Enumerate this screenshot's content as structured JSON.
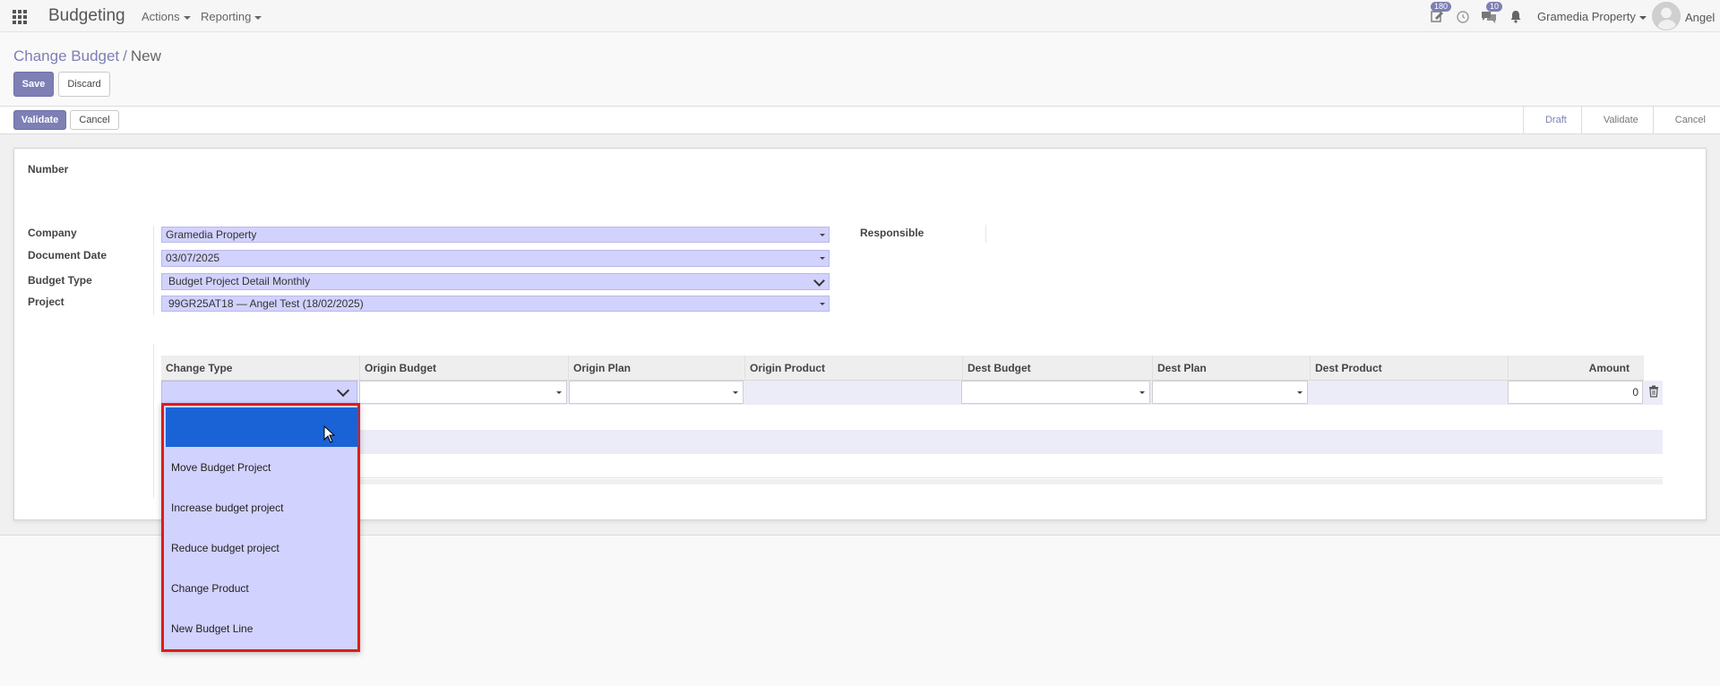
{
  "navbar": {
    "app_title": "Budgeting",
    "menus": [
      "Actions",
      "Reporting"
    ],
    "activity_badge": "180",
    "messages_badge": "10",
    "company": "Gramedia Property",
    "user": "Angel"
  },
  "control_panel": {
    "breadcrumb_parent": "Change Budget",
    "breadcrumb_sep": "/",
    "breadcrumb_current": "New",
    "save_label": "Save",
    "discard_label": "Discard"
  },
  "statusbar": {
    "validate_label": "Validate",
    "cancel_label": "Cancel",
    "stages": [
      "Draft",
      "Validate",
      "Cancel"
    ],
    "active_stage": "Draft"
  },
  "form": {
    "number_label": "Number",
    "company_label": "Company",
    "company_value": "Gramedia Property",
    "document_date_label": "Document Date",
    "document_date_value": "03/07/2025",
    "budget_type_label": "Budget Type",
    "budget_type_value": "Budget Project Detail Monthly",
    "project_label": "Project",
    "project_value": "99GR25AT18 — Angel Test (18/02/2025)",
    "responsible_label": "Responsible"
  },
  "table": {
    "columns": [
      "Change Type",
      "Origin Budget",
      "Origin Plan",
      "Origin Product",
      "Dest Budget",
      "Dest Plan",
      "Dest Product",
      "Amount"
    ],
    "row": {
      "amount": "0"
    }
  },
  "dropdown": {
    "options": [
      "",
      "Move Budget Project",
      "Increase budget project",
      "Reduce budget project",
      "Change Product",
      "New Budget Line"
    ],
    "highlighted_index": 0
  },
  "colors": {
    "accent": "#7d7fb5",
    "field_bg": "#d2d2ff",
    "highlight": "#1a63d6",
    "annotation_border": "#e01b1b"
  }
}
